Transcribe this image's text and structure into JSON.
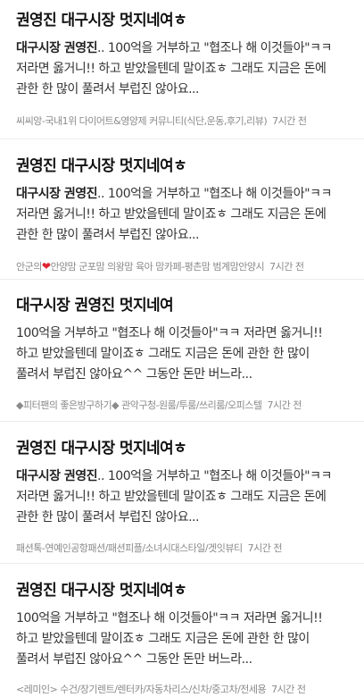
{
  "posts": [
    {
      "title": "권영진 대구시장 멋지네여ㅎ",
      "lines": [
        [
          {
            "t": "대구시장 권영진",
            "b": true
          },
          {
            "t": ".. 100억을 거부하고 \"협조나 해 이것들아\"ㅋㅋ",
            "b": false
          }
        ],
        [
          {
            "t": "저라면 옳거니!! 하고 받았을텐데 말이죠ㅎ 그래도 지금은 돈에",
            "b": false
          }
        ],
        [
          {
            "t": "관한 한 많이 풀려서 부럽진 않아요...",
            "b": false
          }
        ]
      ],
      "source": "씨씨앙-국내1위 다이어트&영양제 커뮤니티(식단,운동,후기,리뷰)",
      "time": "7시간 전"
    },
    {
      "title": "권영진 대구시장 멋지네여ㅎ",
      "lines": [
        [
          {
            "t": "대구시장 권영진",
            "b": true
          },
          {
            "t": ".. 100억을 거부하고 \"협조나 해 이것들아\"ㅋㅋ",
            "b": false
          }
        ],
        [
          {
            "t": "저라면 옳거니!! 하고 받았을텐데 말이죠ㅎ 그래도 지금은 돈에",
            "b": false
          }
        ],
        [
          {
            "t": "관한 한 많이 풀려서 부럽진 않아요...",
            "b": false
          }
        ]
      ],
      "source_prefix": "안군의",
      "source_suffix": "안양맘 군포맘 의왕맘 육아 맘카페-평촌맘 범계맘안양시",
      "time": "7시간 전"
    },
    {
      "title": "대구시장 권영진 멋지네여",
      "lines": [
        [
          {
            "t": "100억을 거부하고 \"협조나 해 이것들아\"ㅋㅋ 저라면 옳거니!!",
            "b": false
          }
        ],
        [
          {
            "t": "하고 받았을텐데 말이죠ㅎ 그래도 지금은 돈에 관한 한 많이",
            "b": false
          }
        ],
        [
          {
            "t": "풀려서 부럽진 않아요^^ 그동안 돈만 버느라...",
            "b": false
          }
        ]
      ],
      "source": "◆피터팬의 좋은방구하기◆ 관악구청-원룸/투룸/쓰리룸/오피스텔",
      "time": "7시간 전"
    },
    {
      "title": "권영진 대구시장 멋지네여ㅎ",
      "lines": [
        [
          {
            "t": "대구시장 권영진",
            "b": true
          },
          {
            "t": ".. 100억을 거부하고 \"협조나 해 이것들아\"ㅋㅋ",
            "b": false
          }
        ],
        [
          {
            "t": "저라면 옳거니!! 하고 받았을텐데 말이죠ㅎ 그래도 지금은 돈에",
            "b": false
          }
        ],
        [
          {
            "t": "관한 한 많이 풀려서 부럽진 않아요...",
            "b": false
          }
        ]
      ],
      "source": "패션톡-연예인공항패션/패션피플/소녀시대스타일/겟잇뷰티",
      "time": "7시간 전"
    },
    {
      "title": "권영진 대구시장 멋지네여ㅎ",
      "lines": [
        [
          {
            "t": "100억을 거부하고 \"협조나 해 이것들아\"ㅋㅋ 저라면 옳거니!!",
            "b": false
          }
        ],
        [
          {
            "t": "하고 받았을텐데 말이죠ㅎ 그래도 지금은 돈에 관한 한 많이",
            "b": false
          }
        ],
        [
          {
            "t": "풀려서 부럽진 않아요^^ 그동안 돈만 버느라...",
            "b": false
          }
        ]
      ],
      "source": "<레미인> 수건/장기렌트/렌터카/자동차리스/신차/중고차/전세용",
      "time": "7시간 전"
    }
  ]
}
